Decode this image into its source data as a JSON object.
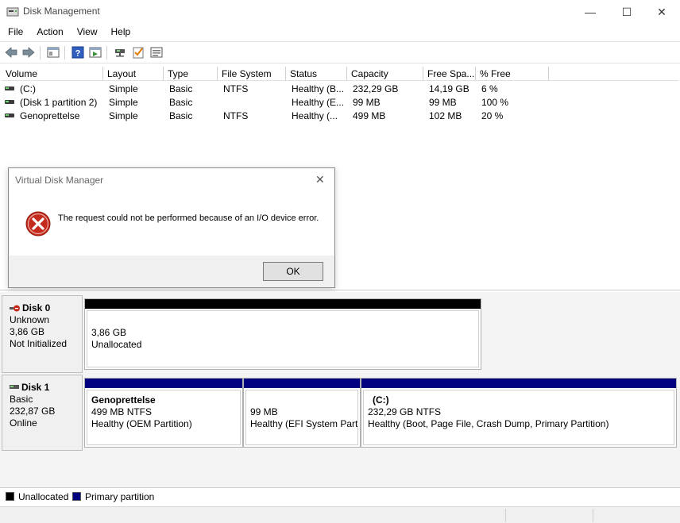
{
  "window": {
    "title": "Disk Management",
    "minimize_symbol": "—",
    "maximize_symbol": "☐",
    "close_symbol": "✕"
  },
  "menu": [
    "File",
    "Action",
    "View",
    "Help"
  ],
  "toolbar_icons": [
    "back-arrow-icon",
    "forward-arrow-icon",
    "show-hide-console-tree-icon",
    "help-icon",
    "refresh-icon",
    "connect-disk-icon",
    "check-properties-icon",
    "list-view-icon"
  ],
  "volume_table": {
    "columns": [
      "Volume",
      "Layout",
      "Type",
      "File System",
      "Status",
      "Capacity",
      "Free Spa...",
      "% Free"
    ],
    "rows": [
      [
        "(C:)",
        "Simple",
        "Basic",
        "NTFS",
        "Healthy (B...",
        "232,29 GB",
        "14,19 GB",
        "6 %"
      ],
      [
        "(Disk 1 partition 2)",
        "Simple",
        "Basic",
        "",
        "Healthy (E...",
        "99 MB",
        "99 MB",
        "100 %"
      ],
      [
        "Genoprettelse",
        "Simple",
        "Basic",
        "NTFS",
        "Healthy (...",
        "499 MB",
        "102 MB",
        "20 %"
      ]
    ]
  },
  "dialog": {
    "title": "Virtual Disk Manager",
    "close_symbol": "✕",
    "message": "The request could not be performed because of an I/O device error.",
    "ok_label": "OK",
    "icon": "error-icon"
  },
  "disks": [
    {
      "name": "Disk 0",
      "type": "Unknown",
      "size": "3,86 GB",
      "state": "Not Initialized",
      "partitions": [
        {
          "name": "",
          "size": "3,86 GB",
          "desc": "Unallocated",
          "bar": "black"
        }
      ]
    },
    {
      "name": "Disk 1",
      "type": "Basic",
      "size": "232,87 GB",
      "state": "Online",
      "partitions": [
        {
          "name": "Genoprettelse",
          "size": "499 MB NTFS",
          "desc": "Healthy (OEM Partition)",
          "bar": "blue"
        },
        {
          "name": "",
          "size": "99 MB",
          "desc": "Healthy (EFI System Partition)",
          "bar": "blue"
        },
        {
          "name": "(C:)",
          "size": "232,29 GB NTFS",
          "desc": "Healthy (Boot, Page File, Crash Dump, Primary Partition)",
          "bar": "blue"
        }
      ]
    }
  ],
  "legend": [
    {
      "label": "Unallocated",
      "color": "#000000"
    },
    {
      "label": "Primary partition",
      "color": "#000080"
    }
  ]
}
